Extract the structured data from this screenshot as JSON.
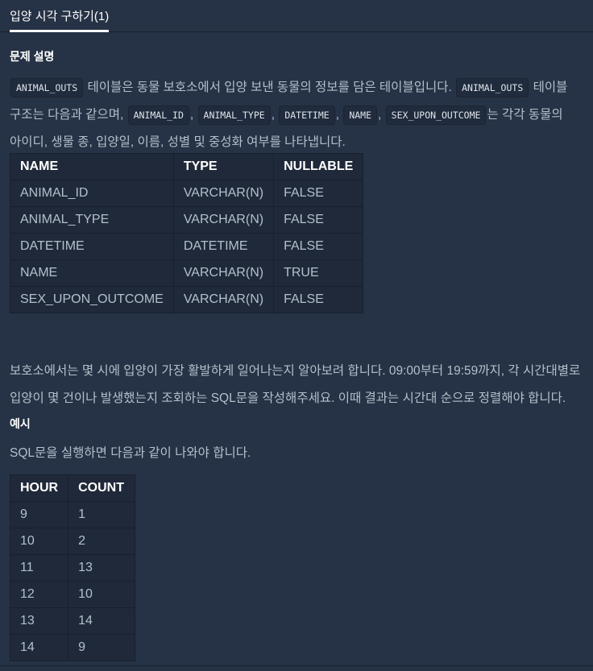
{
  "tab": {
    "title": "입양 시각 구하기(1)"
  },
  "description": {
    "heading": "문제 설명",
    "p1": {
      "code_animal_outs": "ANIMAL_OUTS",
      "text_a": " 테이블은 동물 보호소에서 입양 보낸 동물의 정보를 담은 테이블입니다. ",
      "code_animal_outs_2": "ANIMAL_OUTS",
      "text_b": " 테이블 구조는 다음과 같으며, ",
      "code_animal_id": "ANIMAL_ID",
      "sep1": ", ",
      "code_animal_type": "ANIMAL_TYPE",
      "sep2": ", ",
      "code_datetime": "DATETIME",
      "sep3": ", ",
      "code_name": "NAME",
      "sep4": ", ",
      "code_sex": "SEX_UPON_OUTCOME",
      "text_c": "는 각각 동물의 아이디, 생물 종, 입양일, 이름, 성별 및 중성화 여부를 나타냅니다."
    },
    "schema_table": {
      "headers": [
        "NAME",
        "TYPE",
        "NULLABLE"
      ],
      "rows": [
        [
          "ANIMAL_ID",
          "VARCHAR(N)",
          "FALSE"
        ],
        [
          "ANIMAL_TYPE",
          "VARCHAR(N)",
          "FALSE"
        ],
        [
          "DATETIME",
          "DATETIME",
          "FALSE"
        ],
        [
          "NAME",
          "VARCHAR(N)",
          "TRUE"
        ],
        [
          "SEX_UPON_OUTCOME",
          "VARCHAR(N)",
          "FALSE"
        ]
      ]
    },
    "p2": "보호소에서는 몇 시에 입양이 가장 활발하게 일어나는지 알아보려 합니다. 09:00부터 19:59까지, 각 시간대별로 입양이 몇 건이나 발생했는지 조회하는 SQL문을 작성해주세요. 이때 결과는 시간대 순으로 정렬해야 합니다."
  },
  "example": {
    "heading": "예시",
    "p": "SQL문을 실행하면 다음과 같이 나와야 합니다.",
    "result_table": {
      "headers": [
        "HOUR",
        "COUNT"
      ],
      "rows": [
        [
          "9",
          "1"
        ],
        [
          "10",
          "2"
        ],
        [
          "11",
          "13"
        ],
        [
          "12",
          "10"
        ],
        [
          "13",
          "14"
        ],
        [
          "14",
          "9"
        ]
      ]
    }
  }
}
